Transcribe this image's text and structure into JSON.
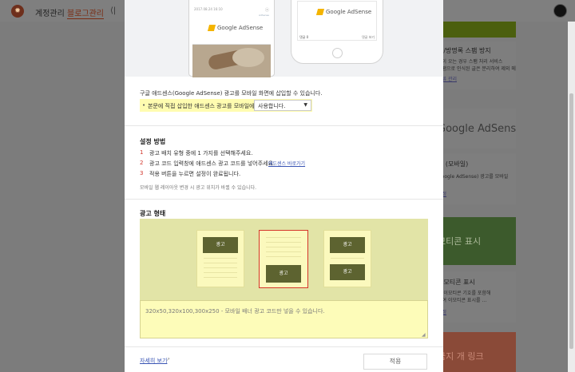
{
  "header": {
    "logo_glyph": "✹",
    "nav": [
      "계정관리",
      "블로그관리"
    ],
    "nav_icon_glyph": "⟨|"
  },
  "right_panel": {
    "spam": {
      "title": "글/방명록 스팸 방지",
      "lines": [
        "글이 오는 경우 스팸 처리 서비스",
        "스팸으로 인식된 글은 분리하여 제외 메",
        "분류 관리"
      ]
    },
    "adsense": {
      "title": "Google AdSense"
    },
    "mobile": {
      "title": "스 (모바일)",
      "lines": [
        "Google AdSense) 광고를 모바일",
        "설정"
      ]
    },
    "emoticon_banner": {
      "title": "모티콘 표시"
    },
    "emoticon": {
      "title": "이모티콘 표시",
      "lines": [
        "이 이모티콘 기호를 포함해",
        "하여 이모티콘 표시를 …",
        "설정"
      ]
    },
    "bottom_banner": {
      "title": "금지 개 링크"
    }
  },
  "modal": {
    "preview": {
      "left_phone": {
        "date": "2017.08.24 16:10",
        "close": "ⓧ",
        "ad_label": "AdSense",
        "ad_text": "Google AdSense"
      },
      "right_phone": {
        "ad_text": "Google AdSense",
        "foot_left": "댓글 0",
        "foot_right": "댓글 보기"
      }
    },
    "description": "구글 애드센스(Google AdSense) 광고를 모바일 화면에 삽입할 수 있습니다.",
    "option": {
      "label": "본문에 직접 삽입한 애드센스 광고를 모바일에서",
      "bullet": "•",
      "selected": "사용합니다.",
      "arrow": "▼"
    },
    "setup": {
      "title": "설정 방법",
      "steps": [
        {
          "num": "1",
          "text": "광고 배치 유형 중에 1 가지를 선택해주세요."
        },
        {
          "num": "2",
          "text": "광고 코드 입력창에 애드센스 광고 코드를 넣어주세요.",
          "link": "애드센스 바로가기"
        },
        {
          "num": "3",
          "text": "적용 버튼을 누르면 설정이 완료됩니다."
        }
      ],
      "note": "모바일 웹 레이아웃 변경 시 광고 위치가 바뀔 수 있습니다."
    },
    "ad_type": {
      "title": "광고 형태",
      "ad_label": "광고",
      "selected_index": 1
    },
    "code_placeholder": "320x50,320x100,300x250 - 모바일 배너 광고 코드만 넣을 수 있습니다.",
    "footer": {
      "more": "자세히 보기",
      "apply": "적용"
    }
  }
}
